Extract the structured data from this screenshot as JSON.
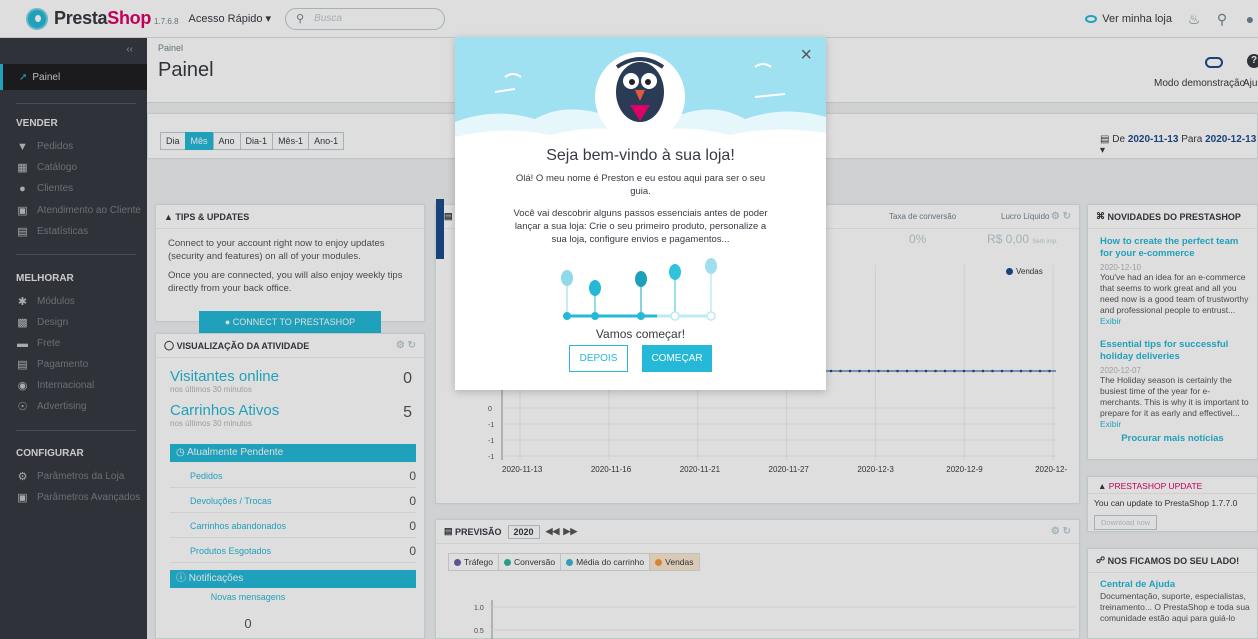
{
  "topbar": {
    "brand_a": "Presta",
    "brand_b": "Shop",
    "version": "1.7.6.8",
    "quick_access": "Acesso Rápido ▾",
    "search_placeholder": "Busca",
    "view_store": "Ver minha loja"
  },
  "sidebar": {
    "collapse": "‹‹",
    "dashboard": "Painel",
    "sections": [
      {
        "title": "VENDER",
        "items": [
          {
            "label": "Pedidos",
            "icon": "shopping-basket-icon"
          },
          {
            "label": "Catálogo",
            "icon": "store-icon"
          },
          {
            "label": "Clientes",
            "icon": "user-icon"
          },
          {
            "label": "Atendimento ao Cliente",
            "icon": "chat-icon"
          },
          {
            "label": "Estatísticas",
            "icon": "bar-chart-icon"
          }
        ]
      },
      {
        "title": "MELHORAR",
        "items": [
          {
            "label": "Módulos",
            "icon": "puzzle-icon"
          },
          {
            "label": "Design",
            "icon": "desktop-icon"
          },
          {
            "label": "Frete",
            "icon": "truck-icon"
          },
          {
            "label": "Pagamento",
            "icon": "credit-card-icon"
          },
          {
            "label": "Internacional",
            "icon": "globe-icon"
          },
          {
            "label": "Advertising",
            "icon": "target-icon"
          }
        ]
      },
      {
        "title": "CONFIGURAR",
        "items": [
          {
            "label": "Parâmetros da Loja",
            "icon": "settings-icon"
          },
          {
            "label": "Parâmetros Avançados",
            "icon": "advanced-settings-icon"
          }
        ]
      }
    ]
  },
  "header": {
    "breadcrumb": "Painel",
    "title": "Painel",
    "demo_mode": "Modo demonstração",
    "help": "Ajuda"
  },
  "period": {
    "buttons": [
      "Dia",
      "Mês",
      "Ano",
      "Dia-1",
      "Mês-1",
      "Ano-1"
    ],
    "active": "Mês",
    "range_prefix": "De",
    "range_from": "2020-11-13",
    "range_mid": "Para",
    "range_to": "2020-12-13"
  },
  "tips": {
    "title": "TIPS & UPDATES",
    "p1": "Connect to your account right now to enjoy updates (security and features) on all of your modules.",
    "p2": "Once you are connected, you will also enjoy weekly tips directly from your back office.",
    "button": "CONNECT TO PRESTASHOP MARKETPLACE"
  },
  "activity": {
    "title": "VISUALIZAÇÃO DA ATIVIDADE",
    "visitors_label": "Visitantes online",
    "visitors_sub": "nos últimos 30 minutos",
    "visitors_value": "0",
    "carts_label": "Carrinhos Ativos",
    "carts_sub": "nos últimos 30 minutos",
    "carts_value": "5",
    "pending_title": "Atualmente Pendente",
    "pending": [
      {
        "label": "Pedidos",
        "value": "0"
      },
      {
        "label": "Devoluções / Trocas",
        "value": "0"
      },
      {
        "label": "Carrinhos abandonados",
        "value": "0"
      },
      {
        "label": "Produtos Esgotados",
        "value": "0"
      }
    ],
    "notifications_title": "Notificações",
    "new_messages": "Novas mensagens",
    "new_messages_value": "0"
  },
  "dashboard": {
    "kpi_conversion_label": "Taxa de conversão",
    "kpi_conversion_value": "0%",
    "kpi_profit_label": "Lucro Líquido",
    "kpi_profit_value": "R$ 0,00",
    "kpi_profit_suffix": "Sem imp.",
    "legend": "Vendas"
  },
  "chart_data": [
    {
      "type": "line",
      "x": [
        "2020-11-13",
        "2020-11-16",
        "2020-11-21",
        "2020-11-27",
        "2020-12-3",
        "2020-12-9",
        "2020-12-"
      ],
      "y_ticks": [
        "0",
        "-1",
        "-1",
        "-1"
      ],
      "series": [
        {
          "name": "Vendas",
          "color": "#1d4b8d"
        }
      ]
    },
    {
      "type": "line",
      "y_ticks": [
        "1.0",
        "0.5"
      ],
      "series": [
        {
          "name": "Tráfego",
          "color": "#6b5fa8"
        },
        {
          "name": "Conversão",
          "color": "#2fb5a1"
        },
        {
          "name": "Média do carrinho",
          "color": "#3cb5d7"
        },
        {
          "name": "Vendas",
          "color": "#f39c3d"
        }
      ]
    }
  ],
  "forecast": {
    "title": "PREVISÃO",
    "year": "2020",
    "prev": "◀◀",
    "next": "▶▶",
    "legend": [
      "Tráfego",
      "Conversão",
      "Média do carrinho",
      "Vendas"
    ]
  },
  "news": {
    "title": "NOVIDADES DO PRESTASHOP",
    "items": [
      {
        "title": "How to create the perfect team for your e-commerce",
        "date": "2020-12-10",
        "text": "You've had an idea for an e-commerce that seems to work great and all you need now is a good team of trustworthy and professional people to entrust...",
        "link": "Exibir"
      },
      {
        "title": "Essential tips for successful holiday deliveries",
        "date": "2020-12-07",
        "text": "The Holiday season is certainly the busiest time of the year for e-merchants. This is why it is important to prepare for it as early and effectivel...",
        "link": "Exibir"
      }
    ],
    "more": "Procurar mais notícias"
  },
  "update": {
    "title": "PRESTASHOP UPDATE",
    "text": "You can update to PrestaShop 1.7.7.0",
    "button": "Download now"
  },
  "help_panel": {
    "title": "NOS FICAMOS DO SEU LADO!",
    "link_title": "Central de Ajuda",
    "text": "Documentação, suporte, especialistas, treinamento... O PrestaShop e toda sua comunidade estão aqui para guiá-lo"
  },
  "modal": {
    "title": "Seja bem-vindo à sua loja!",
    "p1": "Olá! O meu nome é Preston e eu estou aqui para ser o seu guia.",
    "p2": "Você vai descobrir alguns passos essenciais antes de poder lançar a sua loja: Crie o seu primeiro produto, personalize a sua loja, configure envios e pagamentos...",
    "cta_text": "Vamos começar!",
    "later": "DEPOIS",
    "start": "COMEÇAR",
    "close": "×"
  },
  "colors": {
    "accent": "#25b9d7",
    "sidebar": "#363a41",
    "brand_pink": "#df0067"
  }
}
